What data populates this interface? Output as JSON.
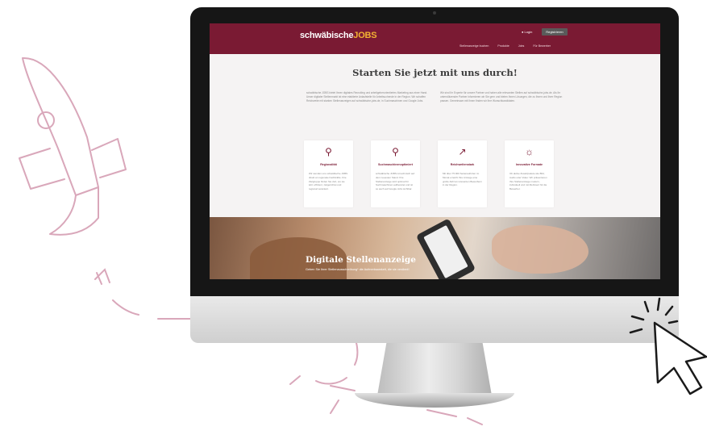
{
  "site": {
    "logo_text": "schwäbische",
    "logo_jobs": "JOBS",
    "login": "Login",
    "register": "Registrieren",
    "nav": [
      "Stellenanzeige buchen",
      "Produkte",
      "Jobs",
      "Für Bewerber"
    ],
    "headline": "Starten Sie jetzt mit uns durch!",
    "intro_left": "schwäbische JOBS bietet Ihnen digitales Recruiting und arbeitgeberorientiertes Marketing aus einer Hand. Unser digitaler Stellenmarkt ist eine etablierte Anlaufstelle für Arbeitsuchende in der Region. Wir schaffen Reichweite mit starken Stellenanzeigen auf schwäbische-jobs.de, in Suchmaschinen und Google Jobs.",
    "intro_right": "Wir sind Ihr Experte für unsere Partner und haben alle relevanten Stellen auf schwäbische-jobs.de. Als Ihr unterstützender Partner informieren wir Sie gern und bieten Ihnen Lösungen, die zu Ihnen und Ihrer Region passen. Gemeinsam mit Ihnen finden wir Ihre Wunschkandidaten.",
    "cards": [
      {
        "icon": "location-pin-icon",
        "title": "Regionalität",
        "body": "Wir wenden uns schwäbische JOBS direkt an regionale Fachkräfte. Ihre Zielgruppe finden Sie dort, wo sie lebt: effizient, zielgerichtet und regional verankert."
      },
      {
        "icon": "magnifier-icon",
        "title": "Suchmaschinenoptimiert",
        "body": "schwäbische JOBS ist technisch auf dem neuesten Stand. Ihre Stellenanzeige wird optimal für Suchmaschinen aufbereitet und ist so auch auf Google Jobs sichtbar."
      },
      {
        "icon": "chart-icon",
        "title": "Reichweitenstark",
        "body": "Mit über 75.000 Seitenaufrufen im Monat erreicht Ihre Anzeige eine große Zahl an relevanten Bewerbern in der Region."
      },
      {
        "icon": "lightbulb-icon",
        "title": "Innovative Formate",
        "body": "Ob aktive Zusatzpakete wie Bild, Audio oder Video: Wir präsentieren Ihre Stellenanzeige modern, individuell und mit Mehrwert für die Bewerber."
      }
    ],
    "banner_title": "Digitale Stellenanzeige",
    "banner_sub": "Geben Sie Ihrer Stellenausschreibung* die Aufmerksamkeit, die sie verdient!"
  },
  "colors": {
    "brand": "#7a1a33",
    "accent": "#f2b233",
    "doodle": "#d9a7ba"
  },
  "decor": {
    "rocket": "rocket-icon",
    "cursor": "cursor-arrow-icon"
  }
}
